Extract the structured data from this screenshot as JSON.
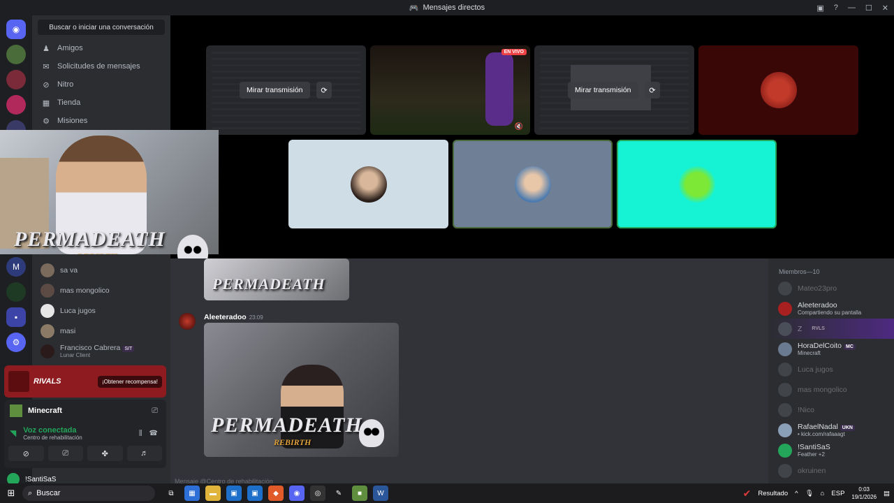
{
  "window": {
    "title": "Mensajes directos",
    "icons": [
      "inbox-icon",
      "help-icon",
      "minimize-icon",
      "maximize-icon",
      "close-icon"
    ]
  },
  "rail": {
    "servers": [
      {
        "name": "discord-home",
        "color": "#5865f2",
        "glyph": "◉"
      },
      {
        "name": "server-1",
        "color": "#4a6b3a",
        "glyph": ""
      },
      {
        "name": "server-2",
        "color": "#7b2a3a",
        "glyph": ""
      },
      {
        "name": "server-3",
        "color": "#b0295a",
        "glyph": ""
      },
      {
        "name": "server-4",
        "color": "#3a3a66",
        "glyph": ""
      }
    ]
  },
  "sidebar": {
    "search_label": "Buscar o iniciar una conversación",
    "nav": [
      {
        "label": "Amigos",
        "icon": "friends-icon",
        "glyph": "♟"
      },
      {
        "label": "Solicitudes de mensajes",
        "icon": "mail-icon",
        "glyph": "✉"
      },
      {
        "label": "Nitro",
        "icon": "nitro-icon",
        "glyph": "⊘"
      },
      {
        "label": "Tienda",
        "icon": "shop-icon",
        "glyph": "▦"
      },
      {
        "label": "Misiones",
        "icon": "quests-icon",
        "glyph": "⚙"
      }
    ],
    "dms": [
      {
        "name": "sa va",
        "sub": "",
        "badge": ""
      },
      {
        "name": "mas mongolico",
        "sub": "",
        "badge": ""
      },
      {
        "name": "Luca jugos",
        "sub": "",
        "badge": ""
      },
      {
        "name": "masi",
        "sub": "",
        "badge": ""
      },
      {
        "name": "Francisco Cabrera",
        "sub": "Lunar Client",
        "badge": "SIT"
      }
    ]
  },
  "promo": {
    "brand": "RIVALS",
    "cta": "¡Obtener recompensa!"
  },
  "voice": {
    "activity": "Minecraft",
    "status": "Voz conectada",
    "channel": "Centro de rehabilitación",
    "user": "!SantiSaS"
  },
  "call": {
    "watch_label": "Mirar transmisión",
    "live_label": "EN VIVO",
    "tile_colors": {
      "tile5": "#cfdde6",
      "tile6": "#6e7f96",
      "tile7": "#16f2d4",
      "tile4": "#3a0707"
    }
  },
  "overlay": {
    "logo_main": "PERMADEATH",
    "logo_sub": "REBIRTH"
  },
  "chat": {
    "author": "Aleeteradoo",
    "time": "23:09",
    "composer_placeholder": "Mensaje @Centro de rehabilitación"
  },
  "members": {
    "header": "Miembros—10",
    "list": [
      {
        "name": "Mateo23pro",
        "sub": "",
        "badge": "",
        "off": true
      },
      {
        "name": "Aleeteradoo",
        "sub": "Compartiendo su pantalla",
        "badge": "",
        "off": false
      },
      {
        "name": "Z",
        "sub": "",
        "badge": "RVLS",
        "off": false,
        "hl": true
      },
      {
        "name": "HoraDelCoito",
        "sub": "Minecraft",
        "badge": "MC",
        "off": false
      },
      {
        "name": "Luca jugos",
        "sub": "",
        "badge": "",
        "off": true
      },
      {
        "name": "mas mongolico",
        "sub": "",
        "badge": "",
        "off": true
      },
      {
        "name": "!Nico",
        "sub": "",
        "badge": "",
        "off": true
      },
      {
        "name": "RafaelNadal",
        "sub": "• kick.com/rafaaagt",
        "badge": "UKN",
        "off": false
      },
      {
        "name": "!SantiSaS",
        "sub": "Feather +2",
        "badge": "",
        "off": false
      },
      {
        "name": "okruinen",
        "sub": "",
        "badge": "",
        "off": true
      }
    ]
  },
  "taskbar": {
    "search": "Buscar",
    "result": "Resultado",
    "lang": "ESP",
    "time": "0:03",
    "date": "19/1/2026"
  }
}
